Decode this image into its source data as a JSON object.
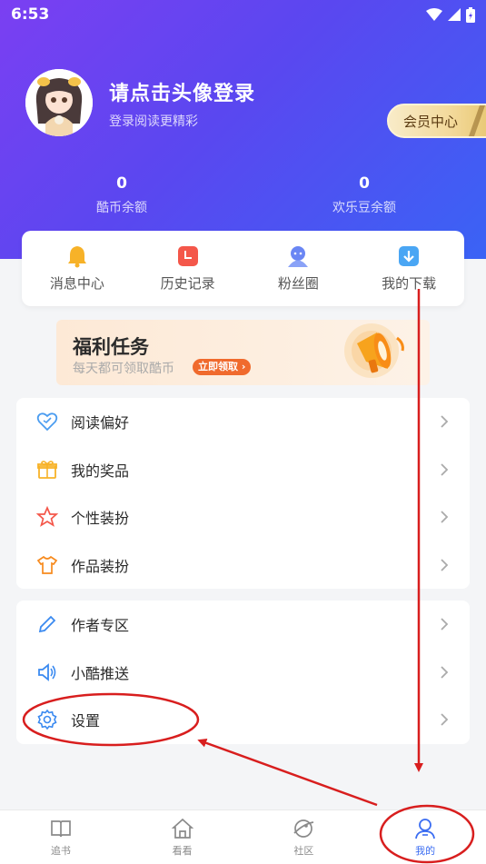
{
  "status": {
    "time": "6:53"
  },
  "profile": {
    "login_title": "请点击头像登录",
    "login_subtitle": "登录阅读更精彩",
    "vip_label": "会员中心"
  },
  "balances": [
    {
      "value": "0",
      "label": "酷币余额"
    },
    {
      "value": "0",
      "label": "欢乐豆余额"
    }
  ],
  "quick_actions": [
    {
      "label": "消息中心",
      "icon": "bell-icon"
    },
    {
      "label": "历史记录",
      "icon": "history-icon"
    },
    {
      "label": "粉丝圈",
      "icon": "fans-icon"
    },
    {
      "label": "我的下载",
      "icon": "download-icon"
    }
  ],
  "banner": {
    "title": "福利任务",
    "subtitle": "每天都可领取酷币",
    "cta": "立即领取"
  },
  "menu_group_1": [
    {
      "label": "阅读偏好",
      "icon": "heart-icon"
    },
    {
      "label": "我的奖品",
      "icon": "gift-icon"
    },
    {
      "label": "个性装扮",
      "icon": "star-icon"
    },
    {
      "label": "作品装扮",
      "icon": "shirt-icon"
    }
  ],
  "menu_group_2": [
    {
      "label": "作者专区",
      "icon": "pen-icon"
    },
    {
      "label": "小酷推送",
      "icon": "speaker-icon"
    },
    {
      "label": "设置",
      "icon": "gear-icon"
    }
  ],
  "tabbar": [
    {
      "label": "追书",
      "icon": "book-icon",
      "active": false
    },
    {
      "label": "看看",
      "icon": "home-icon",
      "active": false
    },
    {
      "label": "社区",
      "icon": "planet-icon",
      "active": false
    },
    {
      "label": "我的",
      "icon": "user-icon",
      "active": true
    }
  ],
  "colors": {
    "header_start": "#7b3ff2",
    "header_end": "#3a63f5",
    "active_tab": "#3b6df2",
    "annotation": "#d81e1e"
  }
}
